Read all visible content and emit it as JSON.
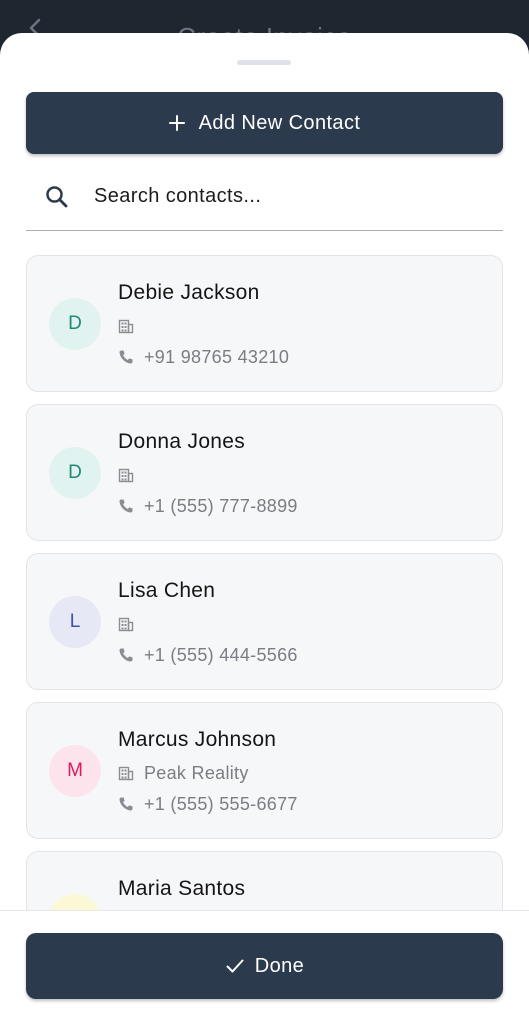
{
  "header": {
    "title": "Create Invoice"
  },
  "sheet": {
    "add_button_label": "Add New Contact",
    "search": {
      "placeholder": "Search contacts...",
      "value": ""
    },
    "done_button_label": "Done"
  },
  "contacts": [
    {
      "initial": "D",
      "name": "Debie Jackson",
      "company": "",
      "phone": "+91 98765 43210",
      "avatar_bg": "#e1f3f0",
      "avatar_fg": "#1f8a76"
    },
    {
      "initial": "D",
      "name": "Donna Jones",
      "company": "",
      "phone": "+1 (555) 777-8899",
      "avatar_bg": "#e1f3f0",
      "avatar_fg": "#1f8a76"
    },
    {
      "initial": "L",
      "name": "Lisa Chen",
      "company": "",
      "phone": "+1 (555) 444-5566",
      "avatar_bg": "#e6e9f5",
      "avatar_fg": "#3f52a8"
    },
    {
      "initial": "M",
      "name": "Marcus Johnson",
      "company": "Peak Reality",
      "phone": "+1 (555) 555-6677",
      "avatar_bg": "#fde4ec",
      "avatar_fg": "#d81b60"
    },
    {
      "initial": "",
      "name": "Maria Santos",
      "company": "",
      "phone": "",
      "avatar_bg": "#fbf8d6",
      "avatar_fg": "#9a8a10"
    }
  ],
  "icons": {
    "back": "chevron-left-icon",
    "add": "plus-icon",
    "search": "search-icon",
    "company": "building-icon",
    "phone": "phone-icon",
    "done": "check-icon"
  },
  "colors": {
    "primary": "#2c3a4d",
    "card_bg": "#f6f7f9",
    "muted_text": "#7a7d83"
  }
}
